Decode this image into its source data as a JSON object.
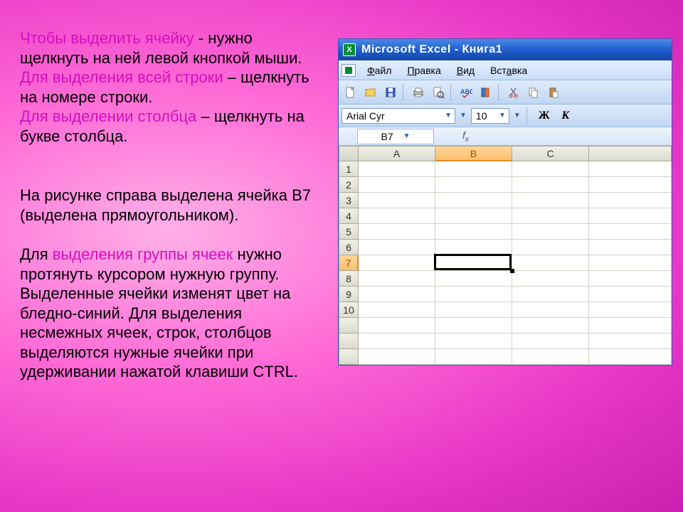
{
  "text": {
    "p1a": "Чтобы выделить ячейку",
    "p1b": "  -  нужно щелкнуть на ней левой кнопкой мыши.",
    "p2a": "Для выделения всей строки",
    "p2b": " – щелкнуть на номере строки.",
    "p3a": "Для выделении столбца",
    "p3b": " – щелкнуть на букве столбца.",
    "p4": "На рисунке справа выделена ячейка B7 (выделена прямоугольником).",
    "p5a": "Для ",
    "p5b": "выделения группы ячеек",
    "p5c": " нужно протянуть курсором нужную группу. Выделенные ячейки изменят цвет на бледно-синий. Для выделения несмежных ячеек, строк, столбцов выделяются нужные ячейки при удерживании нажатой клавиши CTRL."
  },
  "excel": {
    "title": "Microsoft Excel - Книга1",
    "menu": {
      "file": "Файл",
      "edit": "Правка",
      "view": "Вид",
      "insert": "Вставка"
    },
    "font_name": "Arial Cyr",
    "font_size": "10",
    "bold_label": "Ж",
    "italic_label": "К",
    "name_box": "B7",
    "fx_label": "fx",
    "columns": [
      "A",
      "B",
      "C"
    ],
    "rows": [
      "1",
      "2",
      "3",
      "4",
      "5",
      "6",
      "7",
      "8",
      "9",
      "10"
    ],
    "selected_col_index": 1,
    "selected_row_index": 6,
    "grid_rows_blank": 3
  }
}
